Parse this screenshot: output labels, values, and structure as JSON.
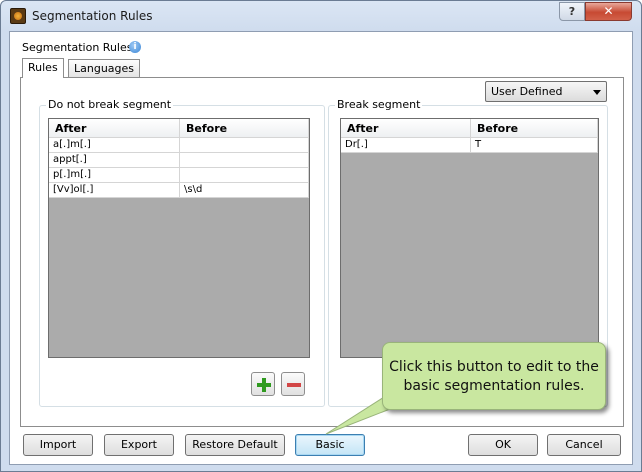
{
  "window": {
    "title": "Segmentation Rules",
    "help_glyph": "?",
    "close_glyph": "✕"
  },
  "header": {
    "label": "Segmentation Rules",
    "info_glyph": "i"
  },
  "tabs": [
    {
      "label": "Rules"
    },
    {
      "label": "Languages"
    }
  ],
  "rule_type": {
    "selected": "User Defined"
  },
  "do_not_break": {
    "title": "Do not break segment",
    "columns": [
      "After",
      "Before"
    ],
    "rows": [
      [
        "a[.]m[.]",
        ""
      ],
      [
        "appt[.]",
        ""
      ],
      [
        "p[.]m[.]",
        ""
      ],
      [
        "[Vv]ol[.]",
        "\\s\\d"
      ]
    ]
  },
  "break_segment": {
    "title": "Break segment",
    "columns": [
      "After",
      "Before"
    ],
    "rows": [
      [
        "Dr[.]",
        "T"
      ]
    ]
  },
  "buttons": {
    "import": "Import",
    "export": "Export",
    "restore_default": "Restore Default",
    "basic": "Basic",
    "ok": "OK",
    "cancel": "Cancel"
  },
  "callout": {
    "line1": "Click this button to edit to the",
    "line2": "basic segmentation rules."
  },
  "colors": {
    "callout_bg": "#c9e7a0",
    "add_green": "#2f9a1f",
    "remove_red": "#d24646"
  }
}
